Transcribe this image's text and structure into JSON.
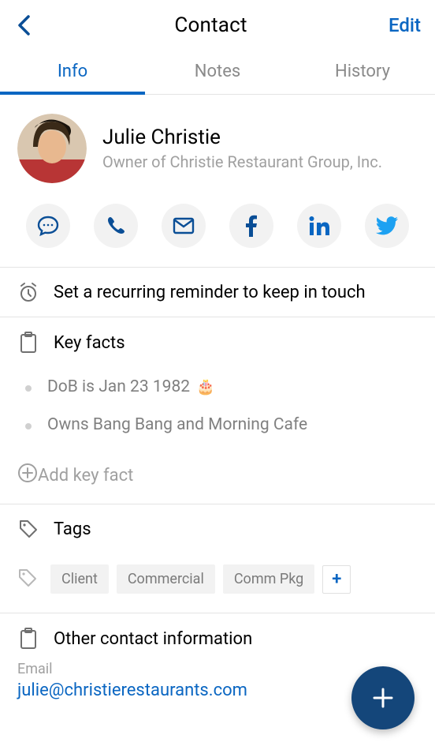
{
  "header": {
    "title": "Contact",
    "edit": "Edit"
  },
  "tabs": {
    "info": "Info",
    "notes": "Notes",
    "history": "History"
  },
  "contact": {
    "name": "Julie Christie",
    "subtitle": "Owner of Christie Restaurant Group, Inc."
  },
  "actions": {
    "icons": [
      "chat-icon",
      "phone-icon",
      "mail-icon",
      "facebook-icon",
      "linkedin-icon",
      "twitter-icon"
    ]
  },
  "reminder": {
    "text": "Set a recurring reminder to keep in touch"
  },
  "keyfacts": {
    "heading": "Key facts",
    "items": [
      "DoB is Jan 23 1982",
      "Owns Bang Bang and Morning Cafe"
    ],
    "add": "Add key fact"
  },
  "tags": {
    "heading": "Tags",
    "items": [
      "Client",
      "Commercial",
      "Comm Pkg"
    ]
  },
  "other": {
    "heading": "Other contact information",
    "email_label": "Email",
    "email": "julie@christierestaurants.com"
  },
  "colors": {
    "primary": "#0a66c2",
    "fab": "#14467a"
  }
}
